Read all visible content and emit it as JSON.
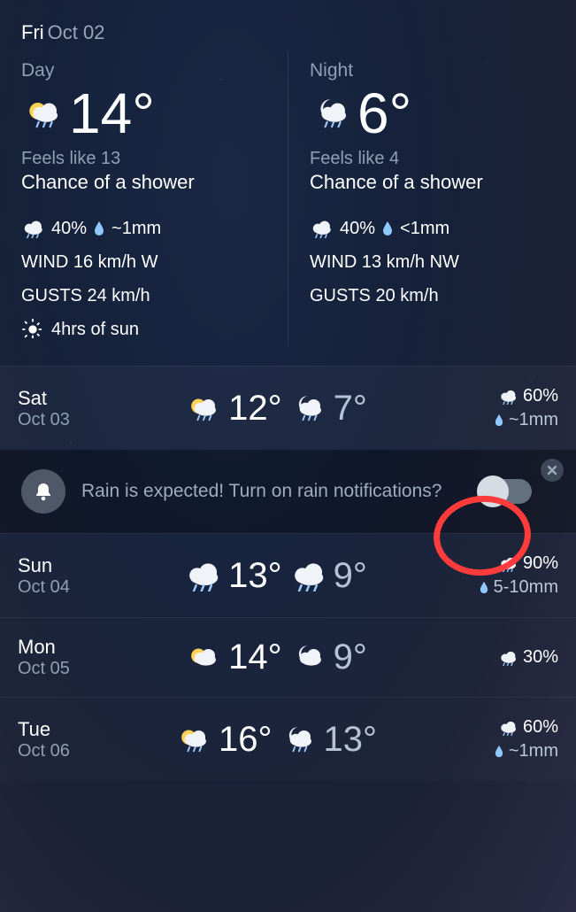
{
  "header": {
    "weekday": "Fri",
    "date": "Oct 02"
  },
  "today": {
    "day": {
      "label": "Day",
      "temp": "14°",
      "feels": "Feels like 13",
      "condition": "Chance of a shower",
      "precip_chance": "40%",
      "precip_amount": "~1mm",
      "wind": "WIND 16 km/h W",
      "gusts": "GUSTS 24 km/h",
      "sun": "4hrs of sun"
    },
    "night": {
      "label": "Night",
      "temp": "6°",
      "feels": "Feels like 4",
      "condition": "Chance of a shower",
      "precip_chance": "40%",
      "precip_amount": "<1mm",
      "wind": "WIND 13 km/h NW",
      "gusts": "GUSTS 20 km/h"
    }
  },
  "notification": {
    "text": "Rain is expected! Turn on rain notifications?",
    "toggle_on": false
  },
  "forecast": [
    {
      "weekday": "Sat",
      "date": "Oct 03",
      "hi": "12°",
      "lo": "7°",
      "precip_chance": "60%",
      "precip_amount": "~1mm",
      "day_icon": "sun-cloud-rain",
      "night_icon": "moon-cloud-rain"
    },
    {
      "weekday": "Sun",
      "date": "Oct 04",
      "hi": "13°",
      "lo": "9°",
      "precip_chance": "90%",
      "precip_amount": "5-10mm",
      "day_icon": "cloud-rain",
      "night_icon": "cloud-rain"
    },
    {
      "weekday": "Mon",
      "date": "Oct 05",
      "hi": "14°",
      "lo": "9°",
      "precip_chance": "30%",
      "precip_amount": "",
      "day_icon": "sun-cloud",
      "night_icon": "moon-cloud"
    },
    {
      "weekday": "Tue",
      "date": "Oct 06",
      "hi": "16°",
      "lo": "13°",
      "precip_chance": "60%",
      "precip_amount": "~1mm",
      "day_icon": "sun-cloud-rain",
      "night_icon": "moon-cloud-rain"
    }
  ]
}
